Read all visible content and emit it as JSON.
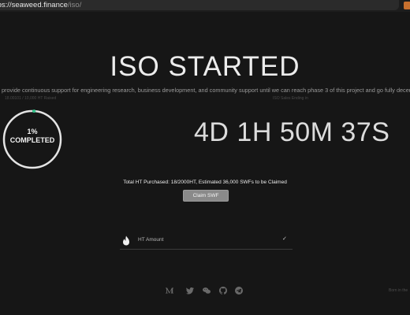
{
  "browser": {
    "url_prefix": "tps://",
    "url_host": "seaweed.finance",
    "url_path": "/iso/",
    "extension_icon": "extension-icon",
    "extension_color": "#c8702e"
  },
  "hero": {
    "title": "ISO STARTED",
    "tagline": "provide continuous support for engineering research, business development, and community support until we can reach phase 3 of this project and go fully decentraliz"
  },
  "stats": {
    "raised_label": "18.00101 / 10,000 HT Raised",
    "ends_label": "ISO Sales Ending in"
  },
  "progress": {
    "percent_label": "1%",
    "completed_label": "COMPLETED",
    "fraction": 0.01,
    "accent_color": "#35c28a"
  },
  "countdown": {
    "value": "4D 1H 50M 37S"
  },
  "purchase": {
    "summary": "Total HT Purchased: 18/2000HT, Estimated 36,000 SWFs to be Claimed",
    "claim_button": "Claim SWF"
  },
  "amount_input": {
    "label": "HT Amount",
    "icon": "flame-icon",
    "check_glyph": "✓"
  },
  "footer": {
    "socials": [
      "medium-icon",
      "twitter-icon",
      "wechat-icon",
      "github-icon",
      "telegram-icon"
    ],
    "born_text": "Born in the"
  },
  "colors": {
    "background": "#161616",
    "text": "#d8d8d8",
    "button": "#8a8a8a"
  }
}
